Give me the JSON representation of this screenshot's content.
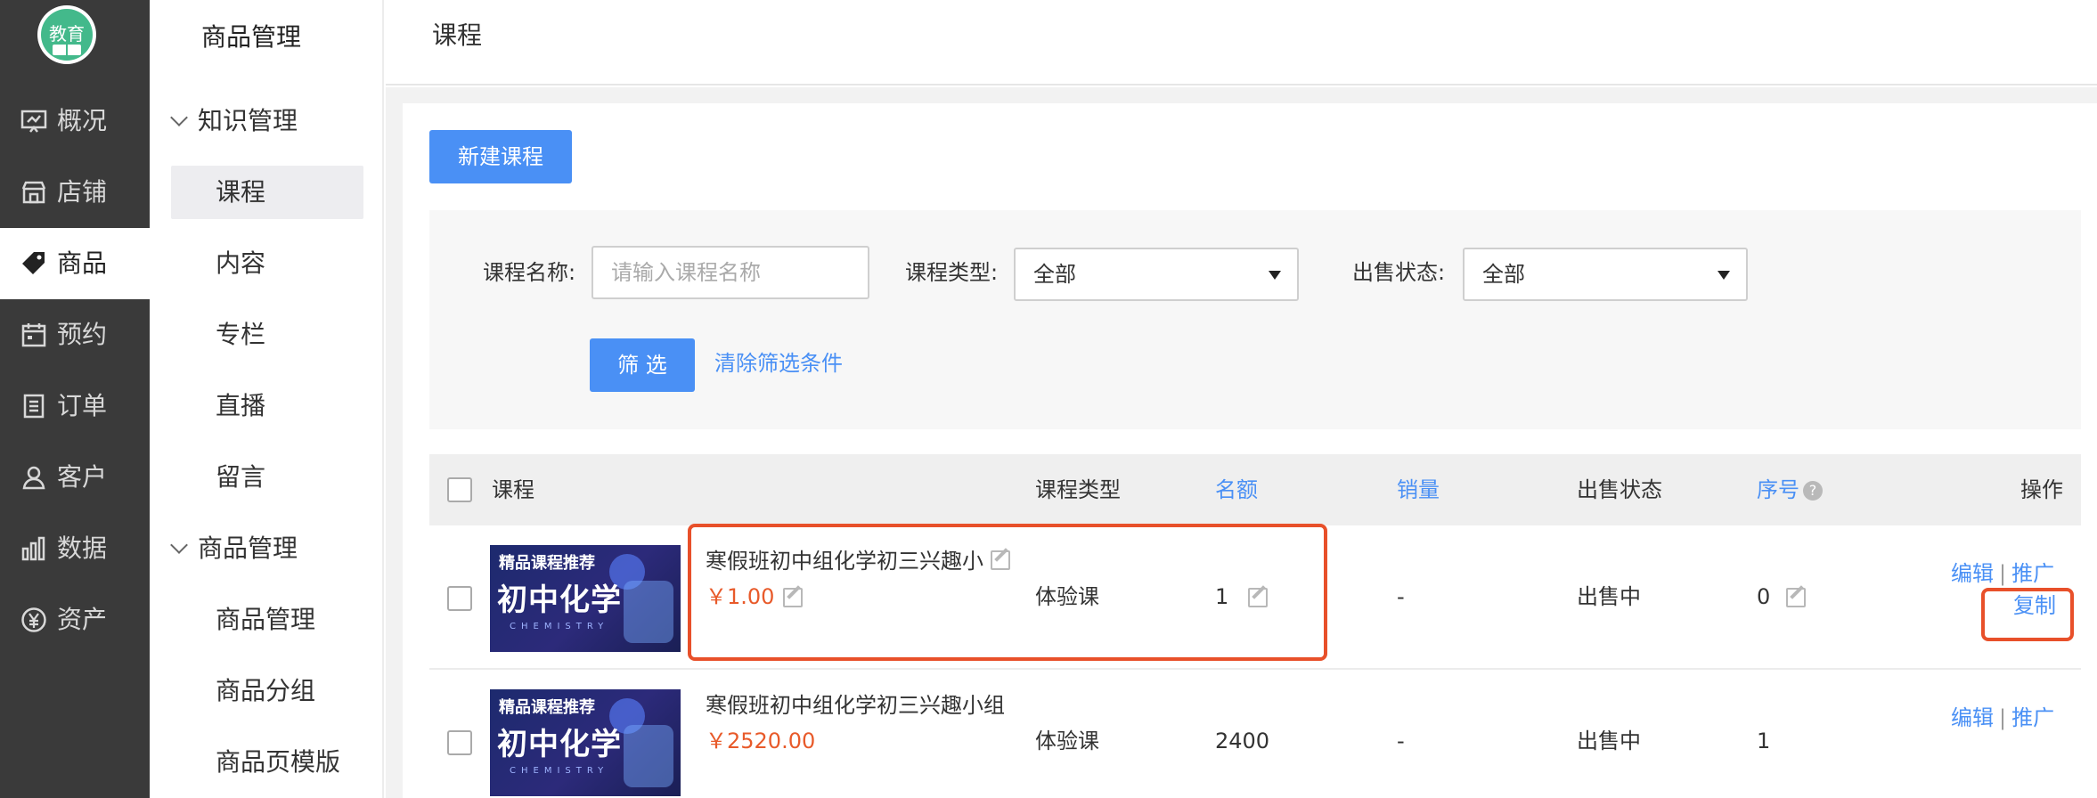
{
  "logo": {
    "text": "教育"
  },
  "nav": [
    {
      "label": "概况",
      "icon": "overview-icon"
    },
    {
      "label": "店铺",
      "icon": "store-icon"
    },
    {
      "label": "商品",
      "icon": "tag-icon"
    },
    {
      "label": "预约",
      "icon": "calendar-icon"
    },
    {
      "label": "订单",
      "icon": "order-icon"
    },
    {
      "label": "客户",
      "icon": "user-icon"
    },
    {
      "label": "数据",
      "icon": "chart-icon"
    },
    {
      "label": "资产",
      "icon": "yuan-icon"
    }
  ],
  "subnav": {
    "title": "商品管理",
    "groups": [
      {
        "label": "知识管理",
        "items": [
          "课程",
          "内容",
          "专栏",
          "直播",
          "留言"
        ]
      },
      {
        "label": "商品管理",
        "items": [
          "商品管理",
          "商品分组",
          "商品页模版"
        ]
      }
    ]
  },
  "header": {
    "title": "课程"
  },
  "toolbar": {
    "new_course": "新建课程"
  },
  "filter": {
    "name_label": "课程名称:",
    "name_placeholder": "请输入课程名称",
    "type_label": "课程类型:",
    "type_value": "全部",
    "status_label": "出售状态:",
    "status_value": "全部",
    "filter_button": "筛 选",
    "clear_link": "清除筛选条件"
  },
  "table": {
    "headers": {
      "course": "课程",
      "type": "课程类型",
      "quota": "名额",
      "sales": "销量",
      "status": "出售状态",
      "order": "序号",
      "order_help": "?",
      "ops": "操作"
    },
    "thumb": {
      "line1": "精品课程推荐",
      "line2": "初中化学",
      "line3": "CHEMISTRY"
    },
    "rows": [
      {
        "title": "寒假班初中组化学初三兴趣小",
        "price": "￥1.00",
        "type": "体验课",
        "quota": "1",
        "sales": "-",
        "status": "出售中",
        "order": "0",
        "edit": "编辑",
        "promote": "推广",
        "copy": "复制",
        "divider": "|"
      },
      {
        "title": "寒假班初中组化学初三兴趣小组",
        "price": "￥2520.00",
        "type": "体验课",
        "quota": "2400",
        "sales": "-",
        "status": "出售中",
        "order": "1",
        "edit": "编辑",
        "promote": "推广",
        "divider": "|"
      }
    ]
  },
  "colors": {
    "accent": "#4a90f5",
    "price": "#e85a2a",
    "highlight": "#e8502a",
    "nav_bg": "#3a3a3a"
  }
}
